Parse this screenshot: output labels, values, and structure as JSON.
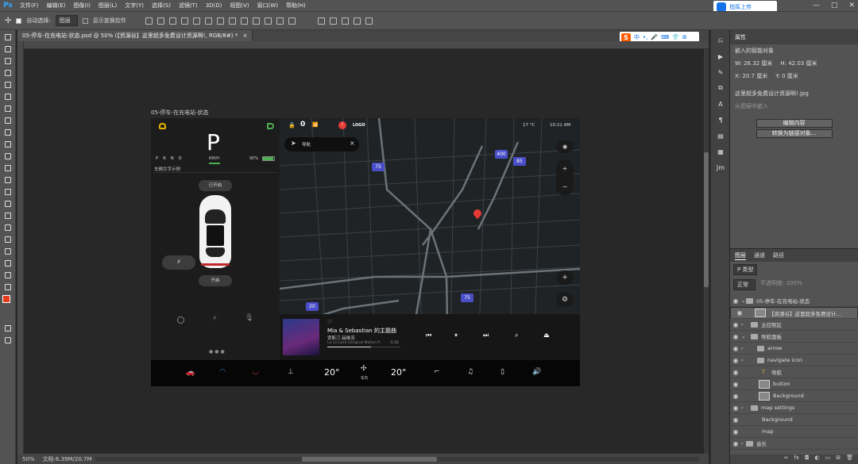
{
  "menubar": {
    "logo": "Ps",
    "items": [
      "文件(F)",
      "编辑(E)",
      "图像(I)",
      "图层(L)",
      "文字(Y)",
      "选择(S)",
      "滤镜(T)",
      "3D(D)",
      "视图(V)",
      "窗口(W)",
      "帮助(H)"
    ]
  },
  "options": {
    "auto_select_label": "自动选择:",
    "auto_select_value": "图层",
    "show_transform_label": "显示变换控件"
  },
  "cloud": {
    "label": "指挥上传"
  },
  "doc_tabs": {
    "active": "05-停车-在充电站-状态.psd @ 50% (【资源谷】这里超多免费设计资源啊!, RGB/8#) *",
    "close": "×"
  },
  "sougou": {
    "logo": "S",
    "label": "中"
  },
  "status": {
    "zoom": "50%",
    "doc": "文档:6.39M/20.7M"
  },
  "artboard_label": "05-停车-在充电站-状态",
  "car": {
    "gear": "P",
    "prnd": "P R N D",
    "speed_unit": "KM/H",
    "battery": "90%",
    "info_text": "车辆文字示例",
    "open_trunk": "已开启",
    "open_frunk": "开启"
  },
  "map": {
    "nav_label": "导航",
    "temp": "17 °C",
    "time": "10:21 AM",
    "shields": [
      "400",
      "85",
      "75",
      "75",
      "20"
    ],
    "zoom_in": "+",
    "zoom_out": "−"
  },
  "topbar": {
    "count": "0",
    "logo": "LOGO"
  },
  "music": {
    "title": "Mia & Sebastian 的主题曲",
    "artist": "贾斯汀·赫维茨",
    "album": "La La Land (Original Motion P...",
    "time": "-1:33"
  },
  "bottom": {
    "temp_left": "20°",
    "temp_right": "20°",
    "fan_label": "车内"
  },
  "properties": {
    "title": "属性",
    "smart_object": "嵌入的智能对象",
    "w": "W: 26.32 厘米",
    "h": "H: 42.03 厘米",
    "x": "X: 20.7 厘米",
    "y": "Y: 0 厘米",
    "file": "这里超多免费设计资源啊!.jpg",
    "unlink": "从图层中嵌入",
    "edit_btn": "编辑内容",
    "convert_btn": "转换为链接对象..."
  },
  "layers": {
    "tabs": [
      "图层",
      "通道",
      "路径"
    ],
    "kind": "P 类型",
    "blend": "正常",
    "opacity": "不透明度: 100%",
    "rows": [
      {
        "name": "05-停车-在充电站-状态",
        "type": "group"
      },
      {
        "name": "【资源谷】这里超多免费设计...",
        "type": "smart"
      },
      {
        "name": "主控制区",
        "type": "folder"
      },
      {
        "name": "导航面板",
        "type": "folder"
      },
      {
        "name": "arrow",
        "type": "folder"
      },
      {
        "name": "navigate icon",
        "type": "folder"
      },
      {
        "name": "导航",
        "type": "text"
      },
      {
        "name": "button",
        "type": "smart"
      },
      {
        "name": "Background",
        "type": "smart"
      },
      {
        "name": "map settings",
        "type": "folder"
      },
      {
        "name": "Background",
        "type": "layer"
      },
      {
        "name": "map",
        "type": "layer"
      },
      {
        "name": "音乐",
        "type": "folder"
      }
    ]
  }
}
